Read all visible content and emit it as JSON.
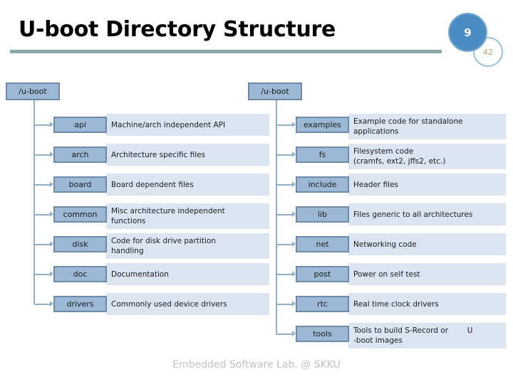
{
  "slide": {
    "title": "U-boot Directory Structure",
    "page_badge": "9",
    "page_total_badge": "42",
    "footer": "Embedded Software Lab. @ SKKU",
    "accent_bar_color": "#8ea8a8",
    "node_fill_color": "#9cb8d4",
    "node_border_color": "#6d8aa8",
    "desc_fill_color": "#dbe5f1",
    "connector_color": "#8fb0cd",
    "badge_color": "#4a8cc4"
  },
  "left_tree": {
    "root": "/u-boot",
    "items": [
      {
        "name": "api",
        "desc_lines": [
          "Machine/arch independent API"
        ]
      },
      {
        "name": "arch",
        "desc_lines": [
          "Architecture specific files"
        ]
      },
      {
        "name": "board",
        "desc_lines": [
          "Board dependent files"
        ]
      },
      {
        "name": "common",
        "desc_lines": [
          "Misc architecture independent",
          "functions"
        ]
      },
      {
        "name": "disk",
        "desc_lines": [
          "Code for disk drive partition",
          "handling"
        ]
      },
      {
        "name": "doc",
        "desc_lines": [
          "Documentation"
        ]
      },
      {
        "name": "drivers",
        "desc_lines": [
          "Commonly used device drivers"
        ]
      }
    ]
  },
  "right_tree": {
    "root": "/u-boot",
    "items": [
      {
        "name": "examples",
        "desc_lines": [
          "Example code for standalone",
          "applications"
        ]
      },
      {
        "name": "fs",
        "desc_lines": [
          "Filesystem code",
          "(cramfs, ext2, jffs2, etc.)"
        ]
      },
      {
        "name": "include",
        "desc_lines": [
          "Header files"
        ]
      },
      {
        "name": "lib",
        "desc_lines": [
          "Files generic to all architectures"
        ]
      },
      {
        "name": "net",
        "desc_lines": [
          "Networking code"
        ]
      },
      {
        "name": "post",
        "desc_lines": [
          "Power on self test"
        ]
      },
      {
        "name": "rtc",
        "desc_lines": [
          "Real time clock drivers"
        ]
      },
      {
        "name": "tools",
        "desc_lines": [
          "Tools to build S-Record or        U",
          "-boot images"
        ]
      }
    ]
  }
}
